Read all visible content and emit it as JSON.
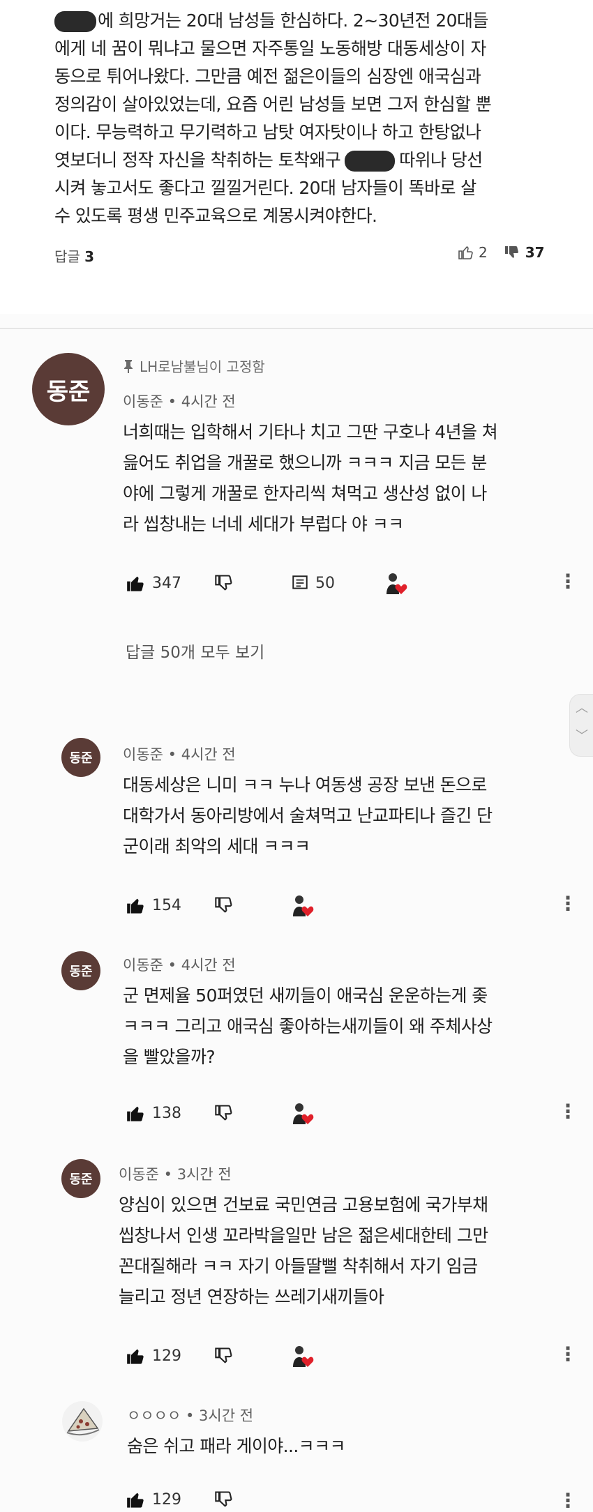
{
  "top_comment": {
    "lines": [
      "에 희망거는 20대 남성들 한심하다. 2~30년전 20대들",
      "에게 네 꿈이 뭐냐고 물으면 자주통일 노동해방 대동세상이 자",
      "동으로 튀어나왔다. 그만큼 예전 젊은이들의 심장엔 애국심과",
      "정의감이 살아있었는데, 요즘 어린 남성들 보면 그저 한심할 뿐",
      "이다. 무능력하고 무기력하고 남탓 여자탓이나 하고 한탕없나",
      "엿보더니 정작 자신을 착취하는 토착왜구",
      "따위나 당선",
      "시켜 놓고서도 좋다고 낄낄거린다. 20대 남자들이 똑바로 살",
      "수 있도록 평생 민주교육으로 계몽시켜야한다."
    ],
    "replies_label": "답글",
    "replies_count": "3",
    "likes": "2",
    "dislikes": "37"
  },
  "pinned": {
    "pin_text": "LH로남불님이 고정함",
    "avatar_text": "동준",
    "author": "이동준",
    "time": "4시간 전",
    "lines": [
      "너희때는 입학해서 기타나 치고 그딴 구호나 4년을 쳐",
      "읊어도 취업을 개꿀로 했으니까 ㅋㅋㅋ 지금 모든 분",
      "야에 그렇게 개꿀로 한자리씩 쳐먹고 생산성 없이 나",
      "라 씹창내는 너네 세대가 부럽다 야 ㅋㅋ"
    ],
    "likes": "347",
    "reply_count": "50",
    "view_replies": "답글 50개 모두 보기"
  },
  "replies": [
    {
      "avatar_text": "동준",
      "author": "이동준",
      "time": "4시간 전",
      "lines": [
        "대동세상은 니미 ㅋㅋ 누나 여동생 공장 보낸 돈으로",
        "대학가서 동아리방에서 술쳐먹고 난교파티나 즐긴 단",
        "군이래 최악의 세대 ㅋㅋㅋ"
      ],
      "likes": "154"
    },
    {
      "avatar_text": "동준",
      "author": "이동준",
      "time": "4시간 전",
      "lines": [
        "군 면제율 50퍼였던 새끼들이 애국심 운운하는게 좆",
        "ㅋㅋㅋ 그리고 애국심 좋아하는새끼들이 왜 주체사상",
        "을 빨았을까?"
      ],
      "likes": "138"
    },
    {
      "avatar_text": "동준",
      "author": "이동준",
      "time": "3시간 전",
      "lines": [
        "양심이 있으면 건보료 국민연금 고용보험에 국가부채",
        "씹창나서 인생 꼬라박을일만 남은 젊은세대한테 그만",
        "꼰대질해라 ㅋㅋ 자기 아들딸뻘 착취해서 자기 임금",
        "늘리고 정년 연장하는 쓰레기새끼들아"
      ],
      "likes": "129"
    },
    {
      "avatar_text": "",
      "author": "ㅇㅇㅇㅇ",
      "time": "3시간 전",
      "lines": [
        "숨은 쉬고 패라 게이야...ㅋㅋㅋ"
      ],
      "likes": "129"
    }
  ],
  "separator": "•",
  "icons": {
    "like": "thumbs-up-icon",
    "dislike": "thumbs-down-icon",
    "reply": "reply-icon",
    "heart": "creator-heart-icon",
    "more": "more-vertical-icon",
    "pin": "pin-icon"
  },
  "colors": {
    "avatar": "#5a3b36",
    "heart": "#e0202a",
    "text": "#1f1f1f",
    "meta": "#5f5f5f"
  }
}
